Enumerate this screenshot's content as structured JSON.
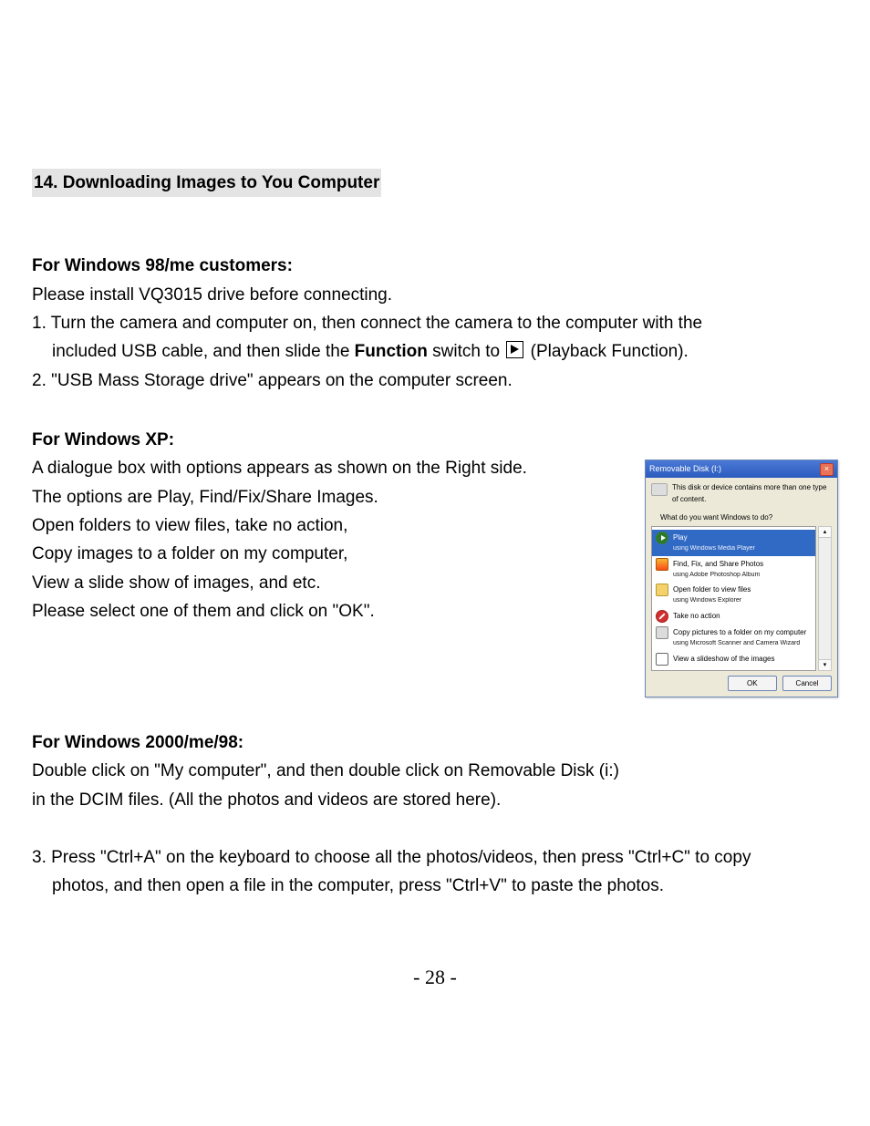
{
  "heading": "14. Downloading Images to You Computer",
  "sec1": {
    "title": "For Windows 98/me customers:",
    "intro": "Please install VQ3015 drive before connecting.",
    "step1a": "1. Turn the camera and computer on, then connect the camera to the computer with the",
    "step1b_pre": "included USB cable, and then slide the ",
    "step1b_bold": "Function",
    "step1b_mid": " switch to ",
    "step1b_post": " (Playback Function).",
    "step2": "2. \"USB Mass Storage drive\" appears on the computer screen."
  },
  "sec2": {
    "title": "For Windows XP:",
    "l1": "A dialogue box with options appears as shown on the Right side.",
    "l2": "The options are Play, Find/Fix/Share Images.",
    "l3": "Open folders to view files, take no action,",
    "l4": "Copy images to a folder on my computer,",
    "l5": "View a slide show of images, and etc.",
    "l6": "Please select one of them and click on \"OK\"."
  },
  "sec3": {
    "title": "For Windows 2000/me/98:",
    "l1": "Double click on \"My computer\", and then double click on Removable Disk (i:)",
    "l2": "in the DCIM files. (All the photos and videos are stored here)."
  },
  "step3a": "3. Press \"Ctrl+A\" on the keyboard to choose all the photos/videos, then press \"Ctrl+C\" to copy",
  "step3b": "photos, and then open a file in the computer, press \"Ctrl+V\" to paste the photos.",
  "dialog": {
    "title": "Removable Disk (I:)",
    "msg": "This disk or device contains more than one type of content.",
    "prompt": "What do you want Windows to do?",
    "items": [
      {
        "t": "Play",
        "s": "using Windows Media Player"
      },
      {
        "t": "Find, Fix, and Share Photos",
        "s": "using Adobe Photoshop Album"
      },
      {
        "t": "Open folder to view files",
        "s": "using Windows Explorer"
      },
      {
        "t": "Take no action",
        "s": ""
      },
      {
        "t": "Copy pictures to a folder on my computer",
        "s": "using Microsoft Scanner and Camera Wizard"
      },
      {
        "t": "View a slideshow of the images",
        "s": ""
      }
    ],
    "ok": "OK",
    "cancel": "Cancel"
  },
  "pagenum": "- 28 -"
}
